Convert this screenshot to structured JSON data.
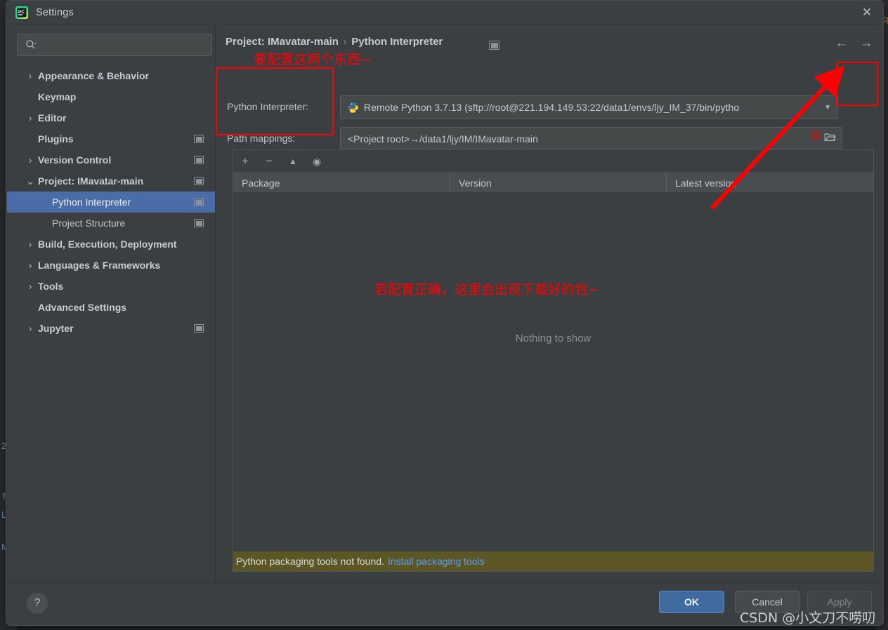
{
  "window": {
    "title": "Settings",
    "logo_icon": "pycharm-logo-icon",
    "close_icon": "close-icon"
  },
  "sidebar": {
    "search": {
      "placeholder": "",
      "icon": "search-icon"
    },
    "items": [
      {
        "label": "Appearance & Behavior",
        "chevron": "›",
        "bold": true,
        "selected": false,
        "badge": false
      },
      {
        "label": "Keymap",
        "chevron": "",
        "bold": true,
        "selected": false,
        "badge": false
      },
      {
        "label": "Editor",
        "chevron": "›",
        "bold": true,
        "selected": false,
        "badge": false
      },
      {
        "label": "Plugins",
        "chevron": "",
        "bold": true,
        "selected": false,
        "badge": true
      },
      {
        "label": "Version Control",
        "chevron": "›",
        "bold": true,
        "selected": false,
        "badge": true
      },
      {
        "label": "Project: IMavatar-main",
        "chevron": "∨",
        "bold": true,
        "selected": false,
        "badge": true
      },
      {
        "label": "Python Interpreter",
        "chevron": "",
        "bold": false,
        "selected": true,
        "badge": true,
        "indent": true
      },
      {
        "label": "Project Structure",
        "chevron": "",
        "bold": false,
        "selected": false,
        "badge": true,
        "indent": true
      },
      {
        "label": "Build, Execution, Deployment",
        "chevron": "›",
        "bold": true,
        "selected": false,
        "badge": false
      },
      {
        "label": "Languages & Frameworks",
        "chevron": "›",
        "bold": true,
        "selected": false,
        "badge": false
      },
      {
        "label": "Tools",
        "chevron": "›",
        "bold": true,
        "selected": false,
        "badge": false
      },
      {
        "label": "Advanced Settings",
        "chevron": "",
        "bold": true,
        "selected": false,
        "badge": false
      },
      {
        "label": "Jupyter",
        "chevron": "›",
        "bold": true,
        "selected": false,
        "badge": true
      }
    ]
  },
  "content": {
    "breadcrumb_root": "Project: IMavatar-main",
    "breadcrumb_sep": "›",
    "breadcrumb_leaf": "Python Interpreter",
    "nav_back_icon": "arrow-left-icon",
    "nav_forward_icon": "arrow-right-icon",
    "interpreter_label": "Python Interpreter:",
    "interpreter_value": "Remote Python 3.7.13 (sftp://root@221.194.149.53:22/data1/envs/ljy_IM_37/bin/pytho",
    "interpreter_icon": "python-icon",
    "interpreter_dropdown_icon": "chevron-down-icon",
    "gear_icon": "gear-icon",
    "path_mappings_label": "Path mappings:",
    "path_mappings_value": "<Project root>→/data1/ljy/IM/IMavatar-main",
    "browse_icon": "folder-icon"
  },
  "packages": {
    "toolbar": [
      {
        "icon": "plus-icon",
        "glyph": "+"
      },
      {
        "icon": "minus-icon",
        "glyph": "−"
      },
      {
        "icon": "upgrade-icon",
        "glyph": "▲"
      },
      {
        "icon": "eye-icon",
        "glyph": "◉"
      }
    ],
    "columns": [
      "Package",
      "Version",
      "Latest version"
    ],
    "rows": [],
    "empty_text": "Nothing to show",
    "warning_text": "Python packaging tools not found.",
    "warning_link": "Install packaging tools"
  },
  "footer": {
    "help_icon": "help-icon",
    "help_glyph": "?",
    "ok": "OK",
    "cancel": "Cancel",
    "apply": "Apply"
  },
  "annotations": {
    "top_note": "要配置这两个东西~",
    "middle_note": "若配置正确，这里会出现下载好的包~",
    "marker_two": "②",
    "highlight_color": "#ff0000",
    "watermark": "CSDN @小文刀不唠叨"
  },
  "backdrop": {
    "line1": "2",
    "line2": "f",
    "line3": "L",
    "line4": "M",
    "right_letter": "R"
  }
}
